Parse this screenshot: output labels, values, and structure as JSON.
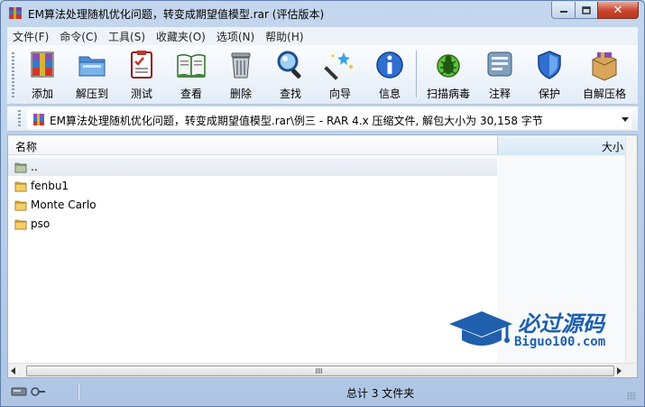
{
  "window": {
    "title": "EM算法处理随机优化问题，转变成期望值模型.rar (评估版本)",
    "accent": "#bcd2ea"
  },
  "menu": [
    "文件(F)",
    "命令(C)",
    "工具(S)",
    "收藏夹(O)",
    "选项(N)",
    "帮助(H)"
  ],
  "toolbar": {
    "add": "添加",
    "extract_to": "解压到",
    "test": "测试",
    "view": "查看",
    "delete": "删除",
    "find": "查找",
    "wizard": "向导",
    "info": "信息",
    "virus_scan": "扫描病毒",
    "comment": "注释",
    "protect": "保护",
    "sfx": "自解压格"
  },
  "address": {
    "text": "EM算法处理随机优化问题，转变成期望值模型.rar\\例三 - RAR 4.x 压缩文件, 解包大小为 30,158 字节"
  },
  "list": {
    "col_name": "名称",
    "col_size": "大小",
    "rows": [
      {
        "name": "..",
        "type": "parent-folder"
      },
      {
        "name": "fenbu1",
        "type": "folder"
      },
      {
        "name": "Monte Carlo",
        "type": "folder"
      },
      {
        "name": "pso",
        "type": "folder"
      }
    ]
  },
  "watermark": {
    "title": "必过源码",
    "sub": "Biguo100.com"
  },
  "status": {
    "summary": "总计 3 文件夹"
  },
  "icons": {
    "app": "winrar-icon",
    "folder": "folder-icon",
    "parent": "parent-folder-icon"
  }
}
